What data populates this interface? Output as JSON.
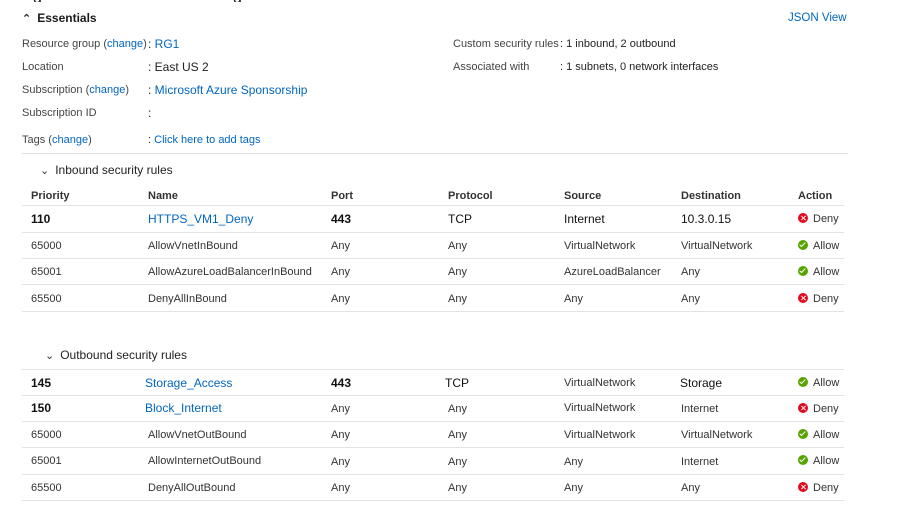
{
  "top_partial": [
    "g",
    "g"
  ],
  "essentials": {
    "title": "Essentials",
    "json_view": "JSON View",
    "resource_group": {
      "label": "Resource group",
      "change": "change",
      "value": "RG1"
    },
    "location": {
      "label": "Location",
      "value": "East US 2"
    },
    "subscription": {
      "label": "Subscription",
      "change": "change",
      "value": "Microsoft Azure Sponsorship"
    },
    "subscription_id": {
      "label": "Subscription ID",
      "value": ""
    },
    "tags": {
      "label": "Tags",
      "change": "change",
      "value": "Click here to add tags"
    },
    "custom_rules": {
      "label": "Custom security rules",
      "value": "1 inbound, 2 outbound"
    },
    "associated": {
      "label": "Associated with",
      "value": "1 subnets, 0 network interfaces"
    }
  },
  "columns": [
    "Priority",
    "Name",
    "Port",
    "Protocol",
    "Source",
    "Destination",
    "Action"
  ],
  "inbound": {
    "title": "Inbound security rules",
    "rows": [
      {
        "priority": "110",
        "name": "HTTPS_VM1_Deny",
        "port": "443",
        "protocol": "TCP",
        "source": "Internet",
        "destination": "10.3.0.15",
        "action": "Deny"
      },
      {
        "priority": "65000",
        "name": "AllowVnetInBound",
        "port": "Any",
        "protocol": "Any",
        "source": "VirtualNetwork",
        "destination": "VirtualNetwork",
        "action": "Allow"
      },
      {
        "priority": "65001",
        "name": "AllowAzureLoadBalancerInBound",
        "port": "Any",
        "protocol": "Any",
        "source": "AzureLoadBalancer",
        "destination": "Any",
        "action": "Allow"
      },
      {
        "priority": "65500",
        "name": "DenyAllInBound",
        "port": "Any",
        "protocol": "Any",
        "source": "Any",
        "destination": "Any",
        "action": "Deny"
      }
    ]
  },
  "outbound": {
    "title": "Outbound security rules",
    "rows": [
      {
        "priority": "145",
        "name": "Storage_Access",
        "port": "443",
        "protocol": "TCP",
        "source": "VirtualNetwork",
        "destination": "Storage",
        "action": "Allow"
      },
      {
        "priority": "150",
        "name": "Block_Internet",
        "port": "Any",
        "protocol": "Any",
        "source": "VirtualNetwork",
        "destination": "Internet",
        "action": "Deny"
      },
      {
        "priority": "65000",
        "name": "AllowVnetOutBound",
        "port": "Any",
        "protocol": "Any",
        "source": "VirtualNetwork",
        "destination": "VirtualNetwork",
        "action": "Allow"
      },
      {
        "priority": "65001",
        "name": "AllowInternetOutBound",
        "port": "Any",
        "protocol": "Any",
        "source": "Any",
        "destination": "Internet",
        "action": "Allow"
      },
      {
        "priority": "65500",
        "name": "DenyAllOutBound",
        "port": "Any",
        "protocol": "Any",
        "source": "Any",
        "destination": "Any",
        "action": "Deny"
      }
    ]
  },
  "colors": {
    "link": "#0066c0",
    "allow": "#57a300",
    "deny": "#e00b1c"
  },
  "icons": {
    "collapse": "chevron-up-icon",
    "expand": "chevron-down-icon",
    "allow": "check-circle-icon",
    "deny": "x-circle-icon"
  }
}
